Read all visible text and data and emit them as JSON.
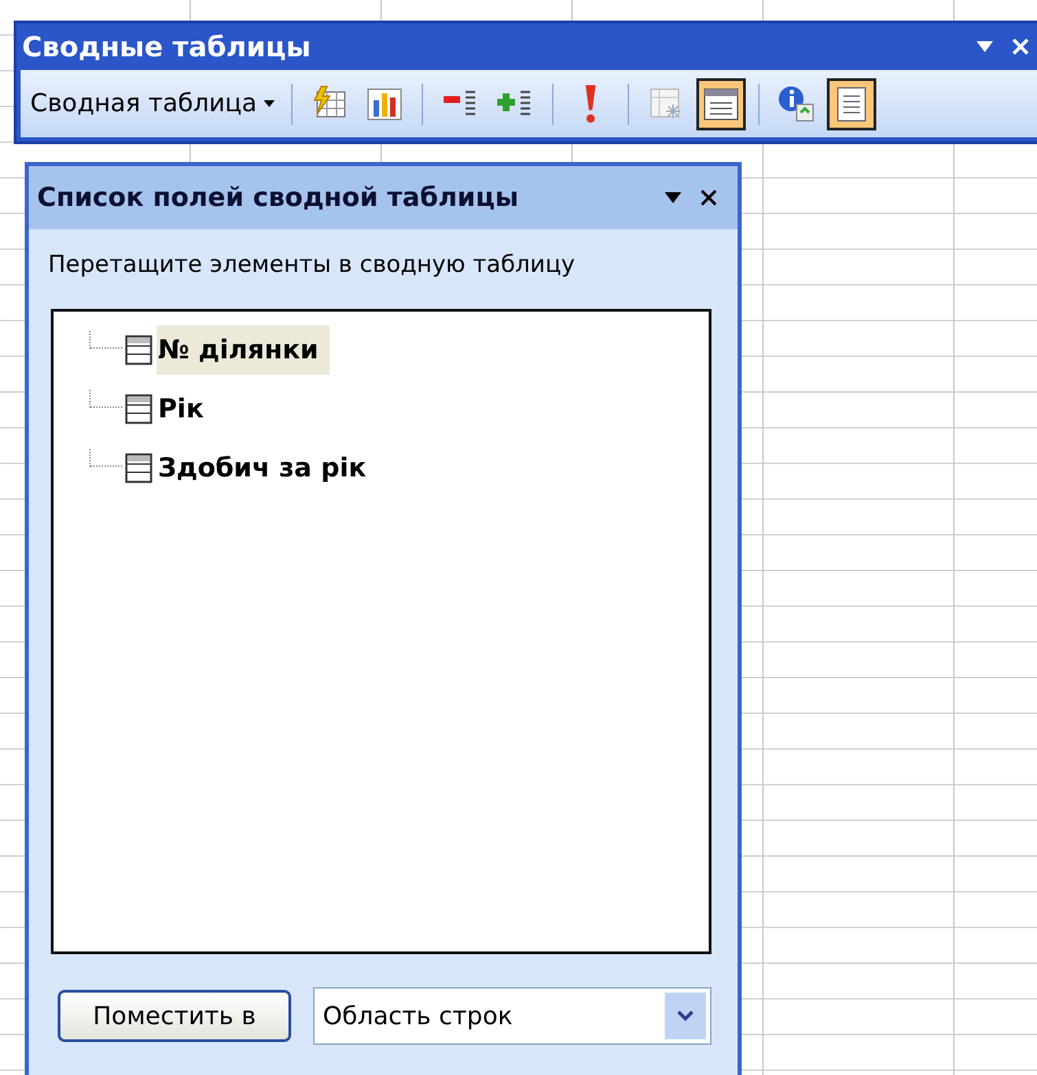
{
  "toolbar_window": {
    "title": "Сводные таблицы",
    "menu_button": "Сводная таблица",
    "tools": [
      {
        "kind": "format",
        "selected": false
      },
      {
        "kind": "chart",
        "selected": false
      },
      {
        "kind": "sep"
      },
      {
        "kind": "hide",
        "selected": false
      },
      {
        "kind": "show",
        "selected": false
      },
      {
        "kind": "sep"
      },
      {
        "kind": "refresh",
        "selected": false
      },
      {
        "kind": "sep"
      },
      {
        "kind": "grid",
        "selected": false
      },
      {
        "kind": "fieldlist",
        "selected": true
      },
      {
        "kind": "sep"
      },
      {
        "kind": "info",
        "selected": false
      },
      {
        "kind": "page",
        "selected": true
      }
    ]
  },
  "field_list": {
    "title": "Список полей сводной таблицы",
    "instruction": "Перетащите элементы в сводную таблицу",
    "fields": [
      {
        "label": "№ ділянки",
        "selected": true
      },
      {
        "label": "Рік",
        "selected": false
      },
      {
        "label": "Здобич за рік",
        "selected": false
      }
    ],
    "add_button": "Поместить в",
    "area_select": {
      "value": "Область строк"
    }
  }
}
